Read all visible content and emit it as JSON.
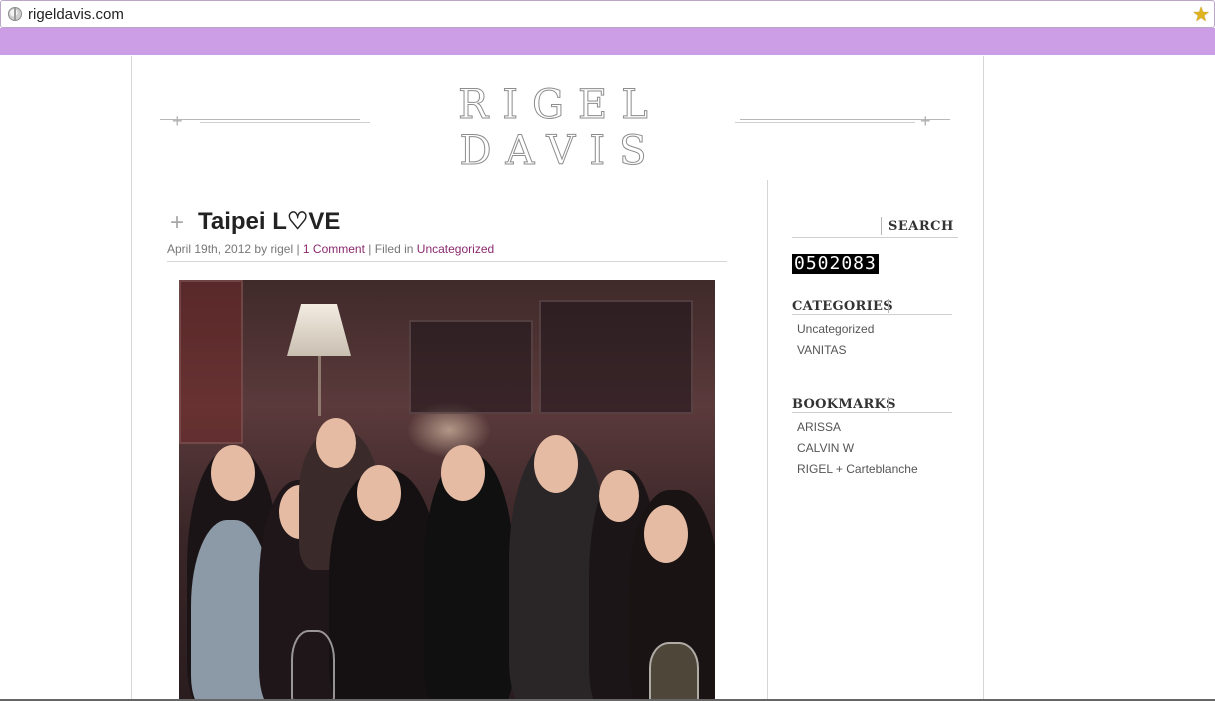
{
  "browser": {
    "url": "rigeldavis.com",
    "icons": {
      "site": "globe-icon",
      "bookmark": "star-icon"
    }
  },
  "header": {
    "logo_text": "RIGEL DAVIS"
  },
  "post": {
    "title": "Taipei L♡VE",
    "date": "April 19th, 2012",
    "by_text": "by",
    "author": "rigel",
    "comments": "1 Comment",
    "filed_text": "Filed in",
    "category": "Uncategorized"
  },
  "sidebar": {
    "search_label": "SEARCH",
    "counter": "0502083",
    "categories": {
      "title": "CATEGORIES",
      "items": [
        "Uncategorized",
        "VANITAS"
      ]
    },
    "bookmarks": {
      "title": "BOOKMARKS",
      "items": [
        "ARISSA",
        "CALVIN W",
        "RIGEL + Carteblanche"
      ]
    }
  },
  "colors": {
    "band": "#cc9ee6",
    "link": "#8a2a6e",
    "title": "#222222",
    "star": "#e0b21d"
  }
}
